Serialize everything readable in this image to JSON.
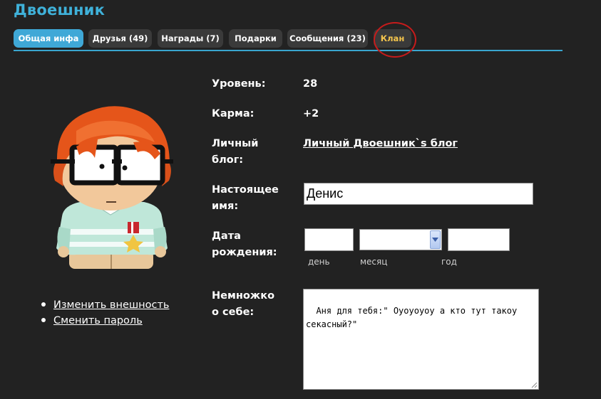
{
  "header": {
    "title": "Двоешник"
  },
  "tabs": [
    {
      "label": "Общая инфа",
      "active": true
    },
    {
      "label": "Друзья (49)"
    },
    {
      "label": "Награды (7)"
    },
    {
      "label": "Подарки"
    },
    {
      "label": "Сообщения (23)"
    },
    {
      "label": "Клан"
    }
  ],
  "profile": {
    "level_label": "Уровень:",
    "level_value": "28",
    "karma_label": "Карма:",
    "karma_value": "+2",
    "blog_label_1": "Личный",
    "blog_label_2": "блог:",
    "blog_link": "Личный Двоешник`s блог",
    "realname_label_1": "Настоящее",
    "realname_label_2": "имя:",
    "realname_value": "Денис",
    "birth_label_1": "Дата",
    "birth_label_2": "рождения:",
    "birth_day_hint": "день",
    "birth_month_hint": "месяц",
    "birth_year_hint": "год",
    "about_label_1": "Немножко",
    "about_label_2": "о себе:",
    "about_value": "Аня для тебя:\" Оуоуоуоу а кто тут такоу секасный?\""
  },
  "side_links": [
    {
      "label": "Изменить внешность"
    },
    {
      "label": "Сменить пароль"
    }
  ],
  "colors": {
    "background": "#222222",
    "title": "#3fb1d9",
    "tab_active": "#3fa8d7",
    "tab_inactive": "#3a3a3a",
    "tab_clan_text": "#f3c44d",
    "highlight_circle": "#c61b1b",
    "avatar_hair": "#e5551a"
  },
  "icons": {
    "avatar": "south-park-avatar",
    "select_arrow": "chevron-down-icon",
    "bullet": "bullet-icon",
    "resize": "resize-grip-icon"
  }
}
